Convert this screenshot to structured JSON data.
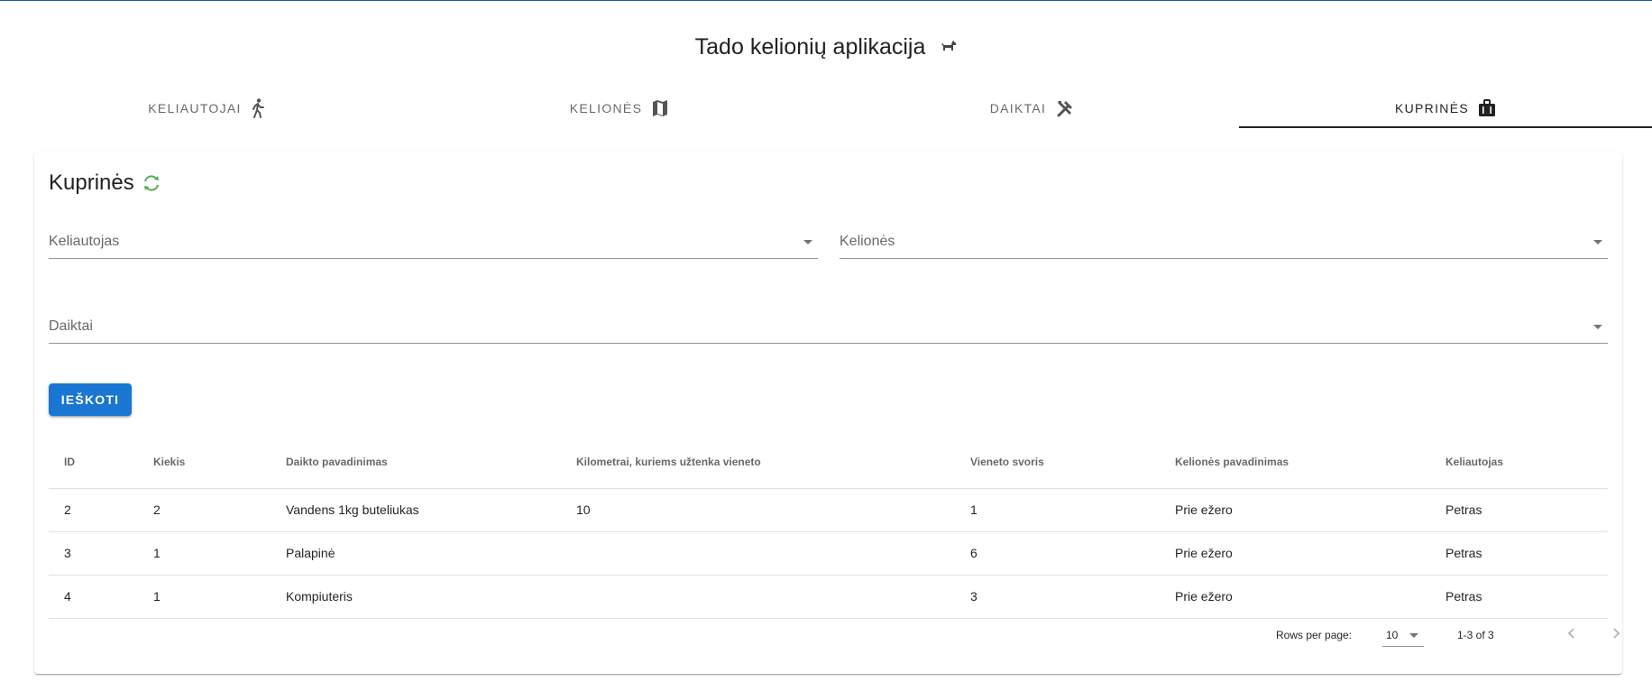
{
  "app": {
    "title": "Tado kelionių aplikacija",
    "title_icon": "dog-icon"
  },
  "tabs": [
    {
      "label": "Keliautojai",
      "icon": "walking-person-icon",
      "active": false
    },
    {
      "label": "Kelionės",
      "icon": "map-icon",
      "active": false
    },
    {
      "label": "Daiktai",
      "icon": "tools-icon",
      "active": false
    },
    {
      "label": "Kuprinės",
      "icon": "bag-icon",
      "active": true
    }
  ],
  "panel": {
    "title": "Kuprinės",
    "refresh_icon": "refresh-icon",
    "refresh_color": "#4caf50",
    "filters": {
      "traveler_label": "Keliautojas",
      "trips_label": "Kelionės",
      "items_label": "Daiktai"
    },
    "search_button": "IEŠKOTI",
    "accent_color": "#1976d2"
  },
  "table": {
    "columns": [
      "ID",
      "Kiekis",
      "Daikto pavadinimas",
      "Kilometrai, kuriems užtenka vieneto",
      "Vieneto svoris",
      "Kelionės pavadinimas",
      "Keliautojas"
    ],
    "rows": [
      [
        "2",
        "2",
        "Vandens 1kg buteliukas",
        "10",
        "1",
        "Prie ežero",
        "Petras"
      ],
      [
        "3",
        "1",
        "Palapinė",
        "",
        "6",
        "Prie ežero",
        "Petras"
      ],
      [
        "4",
        "1",
        "Kompiuteris",
        "",
        "3",
        "Prie ežero",
        "Petras"
      ]
    ]
  },
  "pagination": {
    "rows_per_page_label": "Rows per page:",
    "rows_per_page": "10",
    "range": "1-3 of 3",
    "prev_icon": "chevron-left-icon",
    "next_icon": "chevron-right-icon"
  }
}
